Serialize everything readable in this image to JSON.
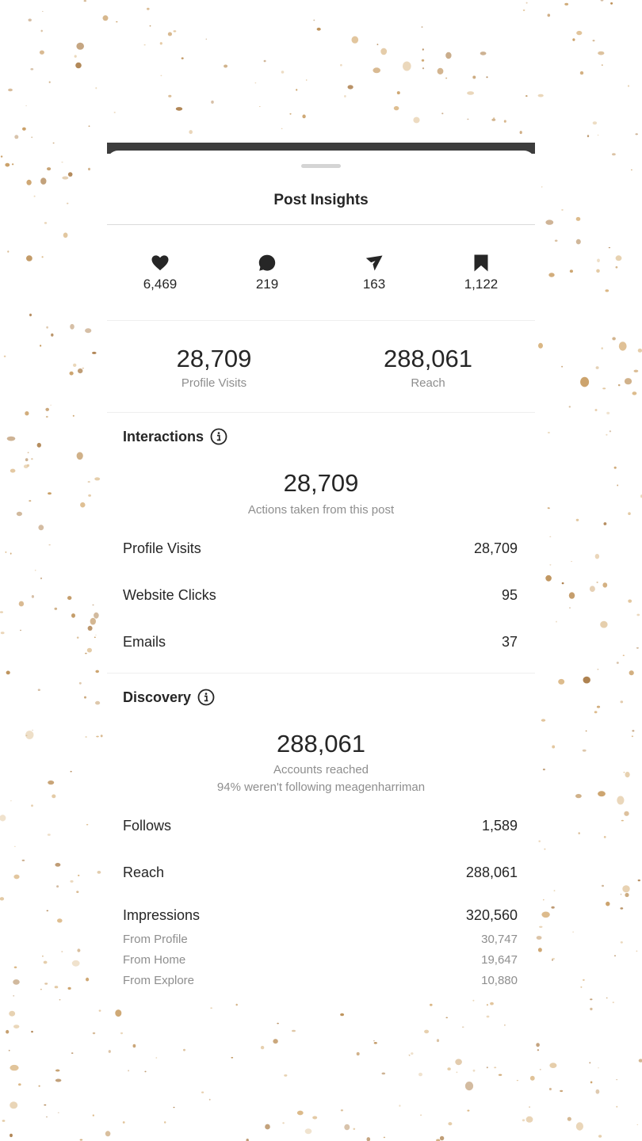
{
  "header": {
    "title": "Post Insights"
  },
  "engagement": [
    {
      "icon": "heart-icon",
      "value": "6,469"
    },
    {
      "icon": "comment-icon",
      "value": "219"
    },
    {
      "icon": "share-icon",
      "value": "163"
    },
    {
      "icon": "bookmark-icon",
      "value": "1,122"
    }
  ],
  "summary": [
    {
      "value": "28,709",
      "label": "Profile Visits"
    },
    {
      "value": "288,061",
      "label": "Reach"
    }
  ],
  "interactions": {
    "title": "Interactions",
    "total": "28,709",
    "caption": "Actions taken from this post",
    "rows": [
      {
        "label": "Profile Visits",
        "value": "28,709"
      },
      {
        "label": "Website Clicks",
        "value": "95"
      },
      {
        "label": "Emails",
        "value": "37"
      }
    ]
  },
  "discovery": {
    "title": "Discovery",
    "total": "288,061",
    "caption": "Accounts reached",
    "caption2": "94% weren't following meagenharriman",
    "rows": [
      {
        "label": "Follows",
        "value": "1,589"
      },
      {
        "label": "Reach",
        "value": "288,061"
      },
      {
        "label": "Impressions",
        "value": "320,560"
      }
    ],
    "subrows": [
      {
        "label": "From Profile",
        "value": "30,747"
      },
      {
        "label": "From Home",
        "value": "19,647"
      },
      {
        "label": "From Explore",
        "value": "10,880"
      }
    ]
  },
  "colors": {
    "text": "#262626",
    "secondary": "#8e8e8e",
    "divider": "#dbdbdb",
    "topbar": "#3d3d3d",
    "speckle": "#c79a5e"
  }
}
